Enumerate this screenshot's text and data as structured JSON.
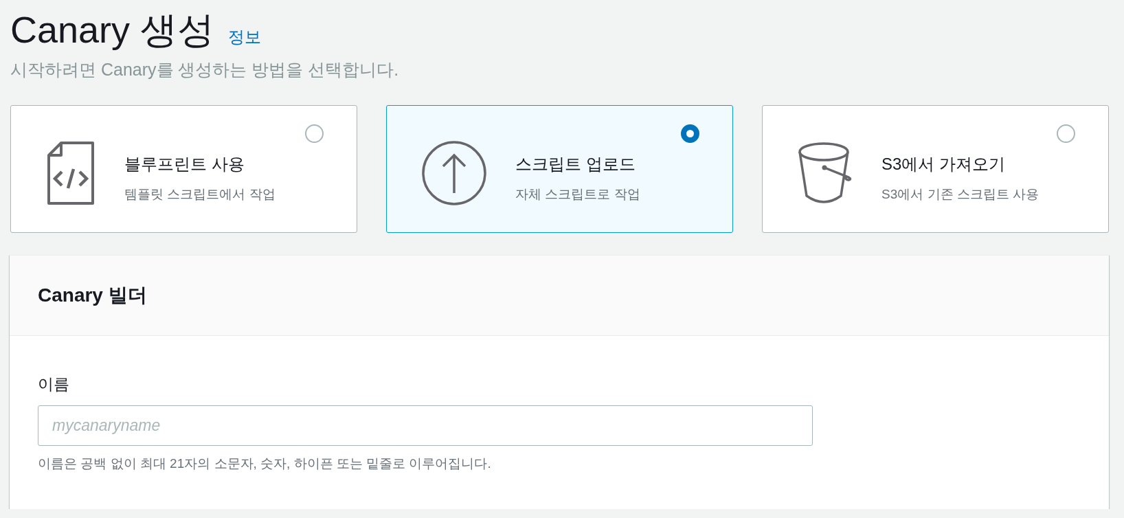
{
  "page": {
    "title": "Canary 생성",
    "info_link": "정보",
    "subtitle": "시작하려면 Canary를 생성하는 방법을 선택합니다."
  },
  "options": [
    {
      "kind": "blueprint",
      "title": "블루프린트 사용",
      "description": "템플릿 스크립트에서 작업",
      "selected": false
    },
    {
      "kind": "upload",
      "title": "스크립트 업로드",
      "description": "자체 스크립트로 작업",
      "selected": true
    },
    {
      "kind": "s3",
      "title": "S3에서 가져오기",
      "description": "S3에서 기존 스크립트 사용",
      "selected": false
    }
  ],
  "builder": {
    "title": "Canary 빌더",
    "fields": [
      {
        "label": "이름",
        "placeholder": "mycanaryname",
        "hint": "이름은 공백 없이 최대 21자의 소문자, 숫자, 하이픈 또는 밑줄로 이루어집니다."
      }
    ]
  }
}
